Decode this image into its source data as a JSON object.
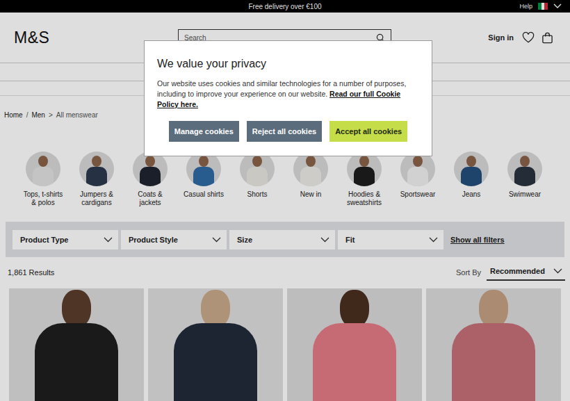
{
  "top_bar": {
    "promo": "Free delivery over €100",
    "help": "Help"
  },
  "header": {
    "logo": "M&S",
    "sign_in": "Sign in"
  },
  "search": {
    "placeholder": "Search"
  },
  "breadcrumb": [
    {
      "label": "Home",
      "separator": "/",
      "current": false
    },
    {
      "label": "Men",
      "separator": ">",
      "current": false
    },
    {
      "label": "All menswear",
      "separator": "",
      "current": true
    }
  ],
  "categories": [
    {
      "label": "Tops, t-shirts & polos"
    },
    {
      "label": "Jumpers & cardigans"
    },
    {
      "label": "Coats & jackets"
    },
    {
      "label": "Casual shirts"
    },
    {
      "label": "Shorts"
    },
    {
      "label": "New in"
    },
    {
      "label": "Hoodies & sweatshirts"
    },
    {
      "label": "Sportswear"
    },
    {
      "label": "Jeans"
    },
    {
      "label": "Swimwear"
    }
  ],
  "filters": [
    {
      "label": "Product Type"
    },
    {
      "label": "Product Style"
    },
    {
      "label": "Size"
    },
    {
      "label": "Fit"
    }
  ],
  "show_all_filters": "Show all filters",
  "results": "1,861 Results",
  "sort": {
    "label": "Sort By",
    "value": "Recommended"
  },
  "cookie_dialog": {
    "title": "We value your privacy",
    "body": "Our website uses cookies and similar technologies for a number of purposes, including to improve your experience on our website.",
    "link": "Read our full Cookie Policy here.",
    "buttons": [
      {
        "label": "Manage cookies",
        "kind": "secondary"
      },
      {
        "label": "Reject all cookies",
        "kind": "secondary"
      },
      {
        "label": "Accept all cookies",
        "kind": "primary"
      }
    ]
  }
}
